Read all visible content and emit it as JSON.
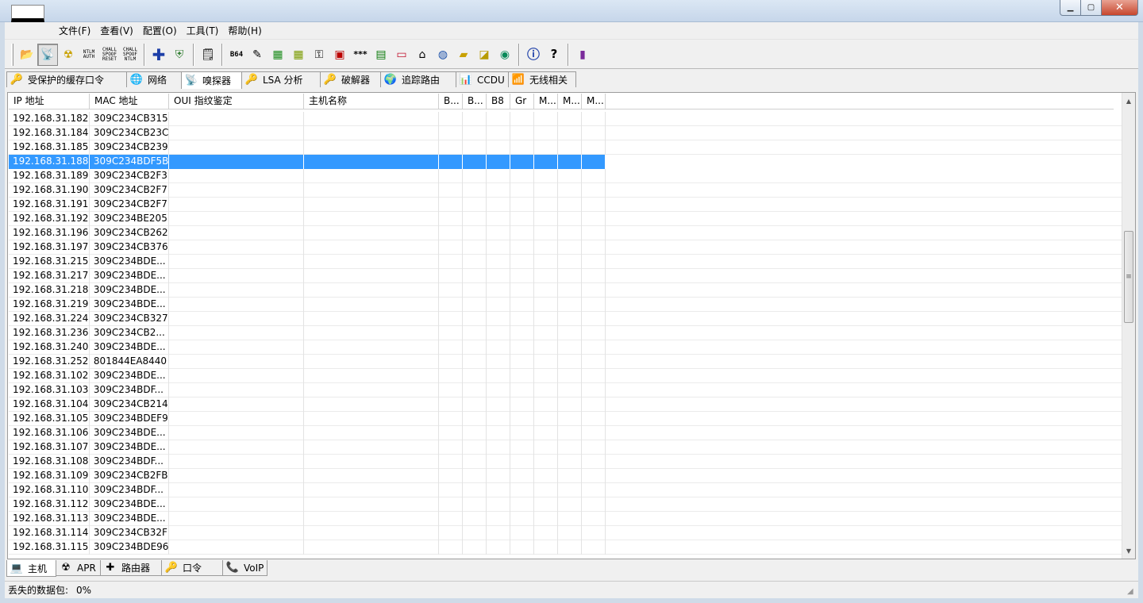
{
  "window": {
    "minimize": "▁",
    "maximize": "▢",
    "close": "✕"
  },
  "menu": [
    {
      "label": "文件(F)",
      "name": "menu-file"
    },
    {
      "label": "查看(V)",
      "name": "menu-view"
    },
    {
      "label": "配置(O)",
      "name": "menu-config"
    },
    {
      "label": "工具(T)",
      "name": "menu-tools"
    },
    {
      "label": "帮助(H)",
      "name": "menu-help"
    }
  ],
  "toolbar": {
    "ntlm_auth": "NTLM AUTH",
    "chall_spoof_reset": "CHALL SPOOF RESET",
    "chall_spoof_ntlm": "CHALL SPOOF NTLM",
    "b64": "B64",
    "stars": "***"
  },
  "top_tabs": [
    {
      "label": "受保护的缓存口令",
      "name": "tab-protected-cache",
      "icon": "🔑",
      "active": false,
      "width": 152
    },
    {
      "label": "网络",
      "name": "tab-network",
      "icon": "🌐",
      "active": false,
      "width": 70
    },
    {
      "label": "嗅探器",
      "name": "tab-sniffer",
      "icon": "📡",
      "active": true,
      "width": 77
    },
    {
      "label": "LSA 分析",
      "name": "tab-lsa",
      "icon": "🔑",
      "active": false,
      "width": 100
    },
    {
      "label": "破解器",
      "name": "tab-cracker",
      "icon": "🔑",
      "active": false,
      "width": 77
    },
    {
      "label": "追踪路由",
      "name": "tab-traceroute",
      "icon": "🌍",
      "active": false,
      "width": 96
    },
    {
      "label": "CCDU",
      "name": "tab-ccdu",
      "icon": "📊",
      "active": false,
      "width": 67
    },
    {
      "label": "无线相关",
      "name": "tab-wireless",
      "icon": "📶",
      "active": false,
      "width": 86
    }
  ],
  "columns": [
    "IP 地址",
    "MAC 地址",
    "OUI 指纹鉴定",
    "主机名称",
    "B...",
    "B...",
    "B8",
    "Gr",
    "M...",
    "M...",
    "M..."
  ],
  "rows": [
    {
      "ip": "192.168.31.182",
      "mac": "309C234CB315"
    },
    {
      "ip": "192.168.31.184",
      "mac": "309C234CB23C"
    },
    {
      "ip": "192.168.31.185",
      "mac": "309C234CB239"
    },
    {
      "ip": "192.168.31.188",
      "mac": "309C234BDF5B",
      "selected": true
    },
    {
      "ip": "192.168.31.189",
      "mac": "309C234CB2F3"
    },
    {
      "ip": "192.168.31.190",
      "mac": "309C234CB2F7"
    },
    {
      "ip": "192.168.31.191",
      "mac": "309C234CB2F7"
    },
    {
      "ip": "192.168.31.192",
      "mac": "309C234BE205"
    },
    {
      "ip": "192.168.31.196",
      "mac": "309C234CB262"
    },
    {
      "ip": "192.168.31.197",
      "mac": "309C234CB376"
    },
    {
      "ip": "192.168.31.215",
      "mac": "309C234BDE..."
    },
    {
      "ip": "192.168.31.217",
      "mac": "309C234BDE..."
    },
    {
      "ip": "192.168.31.218",
      "mac": "309C234BDE..."
    },
    {
      "ip": "192.168.31.219",
      "mac": "309C234BDE..."
    },
    {
      "ip": "192.168.31.224",
      "mac": "309C234CB327"
    },
    {
      "ip": "192.168.31.236",
      "mac": "309C234CB2..."
    },
    {
      "ip": "192.168.31.240",
      "mac": "309C234BDE..."
    },
    {
      "ip": "192.168.31.252",
      "mac": "801844EA8440"
    },
    {
      "ip": "192.168.31.102",
      "mac": "309C234BDE..."
    },
    {
      "ip": "192.168.31.103",
      "mac": "309C234BDF..."
    },
    {
      "ip": "192.168.31.104",
      "mac": "309C234CB214"
    },
    {
      "ip": "192.168.31.105",
      "mac": "309C234BDEF9"
    },
    {
      "ip": "192.168.31.106",
      "mac": "309C234BDE..."
    },
    {
      "ip": "192.168.31.107",
      "mac": "309C234BDE..."
    },
    {
      "ip": "192.168.31.108",
      "mac": "309C234BDF..."
    },
    {
      "ip": "192.168.31.109",
      "mac": "309C234CB2FB"
    },
    {
      "ip": "192.168.31.110",
      "mac": "309C234BDF..."
    },
    {
      "ip": "192.168.31.112",
      "mac": "309C234BDE..."
    },
    {
      "ip": "192.168.31.113",
      "mac": "309C234BDE..."
    },
    {
      "ip": "192.168.31.114",
      "mac": "309C234CB32F"
    },
    {
      "ip": "192.168.31.115",
      "mac": "309C234BDE96"
    }
  ],
  "bottom_tabs": [
    {
      "label": "主机",
      "name": "btab-hosts",
      "icon": "💻",
      "active": true,
      "width": 63
    },
    {
      "label": "APR",
      "name": "btab-apr",
      "icon": "☢",
      "active": false,
      "width": 57
    },
    {
      "label": "路由器",
      "name": "btab-routers",
      "icon": "✚",
      "active": false,
      "width": 78
    },
    {
      "label": "口令",
      "name": "btab-passwords",
      "icon": "🔑",
      "active": false,
      "width": 78
    },
    {
      "label": "VoIP",
      "name": "btab-voip",
      "icon": "📞",
      "active": false,
      "width": 57
    }
  ],
  "status": {
    "label": "丢失的数据包:",
    "value": "0%"
  },
  "colors": {
    "selection": "#3399ff",
    "window_frame": "#cfdbe8"
  }
}
